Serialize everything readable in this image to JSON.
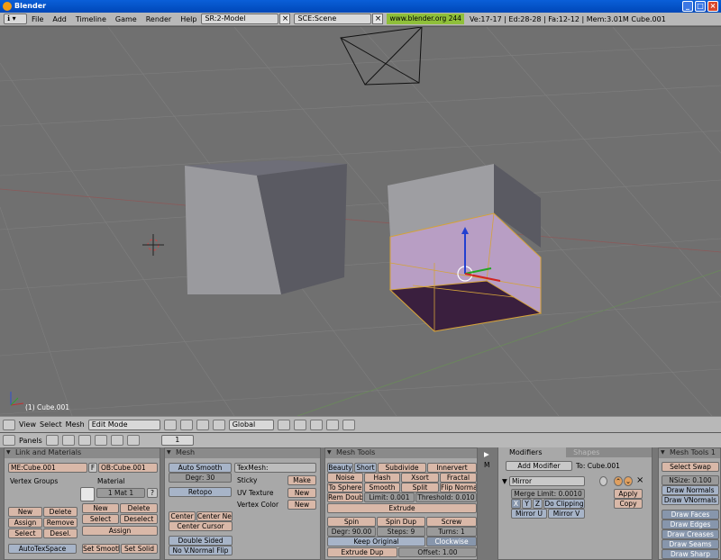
{
  "window": {
    "title": "Blender"
  },
  "menubar": {
    "items": [
      "File",
      "Add",
      "Timeline",
      "Game",
      "Render",
      "Help"
    ],
    "screen": "SR:2-Model",
    "scene": "SCE:Scene",
    "url": "www.blender.org 244",
    "stats": "Ve:17-17 | Ed:28-28 | Fa:12-12 | Mem:3.01M Cube.001"
  },
  "viewport": {
    "object_label": "(1) Cube.001"
  },
  "view_header": {
    "items": [
      "View",
      "Select",
      "Mesh"
    ],
    "mode": "Edit Mode",
    "orientation": "Global"
  },
  "buttons_header": {
    "label": "Panels",
    "frame": "1"
  },
  "link_materials": {
    "title": "Link and Materials",
    "me": "ME:Cube.001",
    "f": "F",
    "ob": "OB:Cube.001",
    "vertex_groups": "Vertex Groups",
    "material": "Material",
    "mat": "1 Mat 1",
    "q": "?",
    "new": "New",
    "delete": "Delete",
    "assign": "Assign",
    "remove": "Remove",
    "select": "Select",
    "desel": "Desel.",
    "new2": "New",
    "delete2": "Delete",
    "select2": "Select",
    "deselect2": "Deselect",
    "assign2": "Assign",
    "autotex": "AutoTexSpace",
    "setsmooth": "Set Smooth",
    "setsolid": "Set Solid"
  },
  "mesh": {
    "title": "Mesh",
    "autosmooth": "Auto Smooth",
    "degr": "Degr: 30",
    "retopo": "Retopo",
    "center": "Center",
    "centernew": "Center New",
    "centercursor": "Center Cursor",
    "doublesided": "Double Sided",
    "novnormal": "No V.Normal Flip",
    "texmesh": "TexMesh:",
    "sticky": "Sticky",
    "uvtex": "UV Texture",
    "vcol": "Vertex Color",
    "make": "Make",
    "new1": "New",
    "new2": "New"
  },
  "meshtools": {
    "title": "Mesh Tools",
    "beauty": "Beauty",
    "short": "Short",
    "subdivide": "Subdivide",
    "innervert": "Innervert",
    "noise": "Noise",
    "hash": "Hash",
    "xsort": "Xsort",
    "fractal": "Fractal",
    "tosphere": "To Sphere",
    "smooth": "Smooth",
    "split": "Split",
    "flipnormal": "Flip Normal",
    "remdoubl": "Rem Doubl",
    "limit": "Limit: 0.001",
    "threshold": "Threshold: 0.010",
    "extrude": "Extrude",
    "spin": "Spin",
    "spindup": "Spin Dup",
    "screw": "Screw",
    "degr": "Degr: 90.00",
    "steps": "Steps: 9",
    "turns": "Turns: 1",
    "keeporiginal": "Keep Original",
    "clockwise": "Clockwise",
    "extrudedup": "Extrude Dup",
    "offset": "Offset: 1.00"
  },
  "modifiers": {
    "tab1": "Modifiers",
    "tab2": "Shapes",
    "add": "Add Modifier",
    "to": "To: Cube.001",
    "name": "Mirror",
    "merge": "Merge Limit: 0.0010",
    "x": "X",
    "y": "Y",
    "z": "Z",
    "doclipping": "Do Clipping",
    "mirroru": "Mirror U",
    "mirrorv": "Mirror V",
    "apply": "Apply",
    "copy": "Copy",
    "m": "M"
  },
  "meshtools1": {
    "title": "Mesh Tools 1",
    "selectswap": "Select Swap",
    "nsize": "NSize: 0.100",
    "drawnormals": "Draw Normals",
    "drawvnormals": "Draw VNormals",
    "drawfaces": "Draw Faces",
    "drawedges": "Draw Edges",
    "drawcreases": "Draw Creases",
    "drawseams": "Draw Seams",
    "drawsharp": "Draw Sharp"
  }
}
